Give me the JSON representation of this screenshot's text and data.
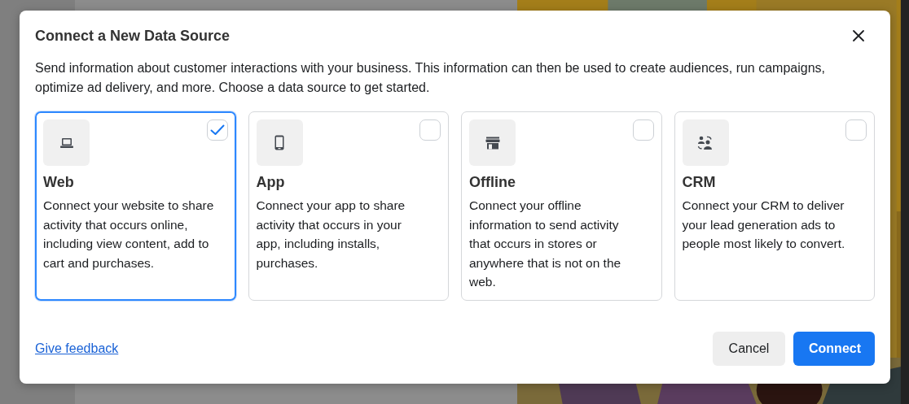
{
  "dialog": {
    "title": "Connect a New Data Source",
    "description": "Send information about customer interactions with your business. This information can then be used to create audiences, run campaigns, optimize ad delivery, and more. Choose a data source to get started.",
    "sources": [
      {
        "kind": "laptop",
        "title": "Web",
        "text": "Connect your website to share activity that occurs online, including view content, add to cart and purchases.",
        "selected": true
      },
      {
        "kind": "phone",
        "title": "App",
        "text": "Connect your app to share activity that occurs in your app, including installs, purchases.",
        "selected": false
      },
      {
        "kind": "store",
        "title": "Offline",
        "text": "Connect your offline information to send activity that occurs in stores or anywhere that is not on the web.",
        "selected": false
      },
      {
        "kind": "people",
        "title": "CRM",
        "text": "Connect your CRM to deliver your lead generation ads to people most likely to convert.",
        "selected": false
      }
    ],
    "feedback_link": "Give feedback",
    "buttons": {
      "cancel": "Cancel",
      "confirm": "Connect"
    }
  }
}
